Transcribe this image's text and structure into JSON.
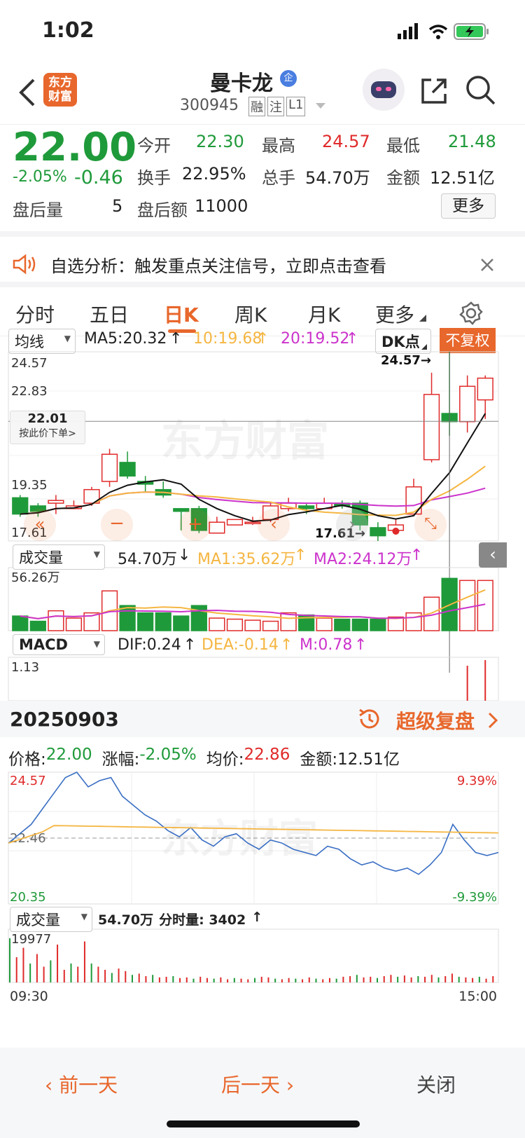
{
  "status_bar": {
    "time": "1:02",
    "icons": [
      "signal-icon",
      "wifi-icon",
      "battery-charging-icon"
    ]
  },
  "header": {
    "logo_text": "东方\n财富",
    "stock_name": "曼卡龙",
    "badge": "企",
    "code": "300945",
    "tags": [
      "融",
      "注",
      "L1"
    ]
  },
  "quote": {
    "price": "22.00",
    "change_pct": "-2.05%",
    "change_val": "-0.46",
    "open_label": "今开",
    "open": "22.30",
    "high_label": "最高",
    "high": "24.57",
    "low_label": "最低",
    "low": "21.48",
    "turnover_label": "换手",
    "turnover": "22.95%",
    "vol_label": "总手",
    "vol": "54.70万",
    "amount_label": "金额",
    "amount": "12.51亿",
    "ah_vol_label": "盘后量",
    "ah_vol": "5",
    "ah_amt_label": "盘后额",
    "ah_amt": "11000",
    "more_button": "更多"
  },
  "banner": {
    "text": "自选分析：触发重点关注信号，立即点击查看"
  },
  "tabs": [
    "分时",
    "五日",
    "日K",
    "周K",
    "月K",
    "更多"
  ],
  "active_tab": "日K",
  "kline": {
    "ma_select": "均线",
    "ma5": "MA5:20.32",
    "ma10": "10:19.68",
    "ma20": "20:19.52",
    "dk_button": "DK点",
    "fq_button": "不复权",
    "y_top": "24.57",
    "y_mid": "22.83",
    "y_low": "19.35",
    "y_bottom": "17.61",
    "cursor_price": "22.01",
    "cursor_hint": "按此价下单>",
    "high_mark": "24.57→",
    "low_mark": "17.61→",
    "watermark": "东方财富"
  },
  "volume": {
    "select": "成交量",
    "value": "54.70万",
    "ma1": "MA1:35.62万",
    "ma2": "MA2:24.12万",
    "y_top": "56.26万"
  },
  "macd": {
    "select": "MACD",
    "dif": "DIF:0.24",
    "dea": "DEA:-0.14",
    "m": "M:0.78",
    "y_top": "1.13"
  },
  "intraday": {
    "date": "20250903",
    "replay": "超级复盘",
    "price_label": "价格:",
    "price": "22.00",
    "chg_label": "涨幅:",
    "chg": "-2.05%",
    "avg_label": "均价:",
    "avg": "22.86",
    "amt_label": "金额:",
    "amt": "12.51亿",
    "y_top": "24.57",
    "y_mid": "22.46",
    "y_bottom": "20.35",
    "pct_top": "9.39%",
    "pct_bottom": "-9.39%",
    "vol_select": "成交量",
    "vol_value": "54.70万",
    "vol_split": "分时量: 3402",
    "vol_top": "19977",
    "t_start": "09:30",
    "t_end": "15:00"
  },
  "footer": {
    "prev": "前一天",
    "next": "后一天",
    "close": "关闭"
  },
  "colors": {
    "up": "#e02a2a",
    "down": "#1f9a3a",
    "accent": "#e8672c",
    "ma10": "#f5b642",
    "ma20": "#cc33cc",
    "line": "#3a6fc4"
  },
  "candles": [
    {
      "o": 19.2,
      "c": 18.6,
      "h": 19.3,
      "l": 18.5
    },
    {
      "o": 18.9,
      "c": 18.7,
      "h": 19.0,
      "l": 18.5
    },
    {
      "o": 19.0,
      "c": 19.1,
      "h": 19.3,
      "l": 18.6
    },
    {
      "o": 18.8,
      "c": 18.9,
      "h": 19.1,
      "l": 18.8
    },
    {
      "o": 19.0,
      "c": 19.5,
      "h": 19.6,
      "l": 18.9
    },
    {
      "o": 19.8,
      "c": 20.8,
      "h": 21.0,
      "l": 19.6
    },
    {
      "o": 20.5,
      "c": 20.0,
      "h": 20.9,
      "l": 19.9
    },
    {
      "o": 19.8,
      "c": 19.7,
      "h": 20.0,
      "l": 19.4
    },
    {
      "o": 19.5,
      "c": 19.3,
      "h": 19.8,
      "l": 19.2
    },
    {
      "o": 18.8,
      "c": 18.7,
      "h": 18.8,
      "l": 18.0
    },
    {
      "o": 18.8,
      "c": 18.0,
      "h": 18.9,
      "l": 17.9
    },
    {
      "o": 17.9,
      "c": 18.3,
      "h": 18.5,
      "l": 17.9
    },
    {
      "o": 18.2,
      "c": 18.4,
      "h": 18.4,
      "l": 18.2
    },
    {
      "o": 18.3,
      "c": 18.3,
      "h": 18.5,
      "l": 18.2
    },
    {
      "o": 18.4,
      "c": 18.9,
      "h": 19.0,
      "l": 18.3
    },
    {
      "o": 18.8,
      "c": 19.0,
      "h": 19.2,
      "l": 18.7
    },
    {
      "o": 18.9,
      "c": 18.8,
      "h": 19.0,
      "l": 18.6
    },
    {
      "o": 18.8,
      "c": 19.0,
      "h": 19.2,
      "l": 18.8
    },
    {
      "o": 19.0,
      "c": 18.9,
      "h": 19.1,
      "l": 18.8
    },
    {
      "o": 19.0,
      "c": 18.2,
      "h": 19.1,
      "l": 18.0
    },
    {
      "o": 18.1,
      "c": 17.8,
      "h": 18.3,
      "l": 17.61
    },
    {
      "o": 18.0,
      "c": 18.2,
      "h": 18.4,
      "l": 17.9
    },
    {
      "o": 18.6,
      "c": 19.6,
      "h": 19.9,
      "l": 18.6
    },
    {
      "o": 20.6,
      "c": 23.0,
      "h": 23.8,
      "l": 20.5
    },
    {
      "o": 22.3,
      "c": 22.0,
      "h": 24.57,
      "l": 21.48
    },
    {
      "o": 22.0,
      "c": 23.3,
      "h": 23.7,
      "l": 21.6
    },
    {
      "o": 22.8,
      "c": 23.6,
      "h": 23.7,
      "l": 22.1
    }
  ]
}
